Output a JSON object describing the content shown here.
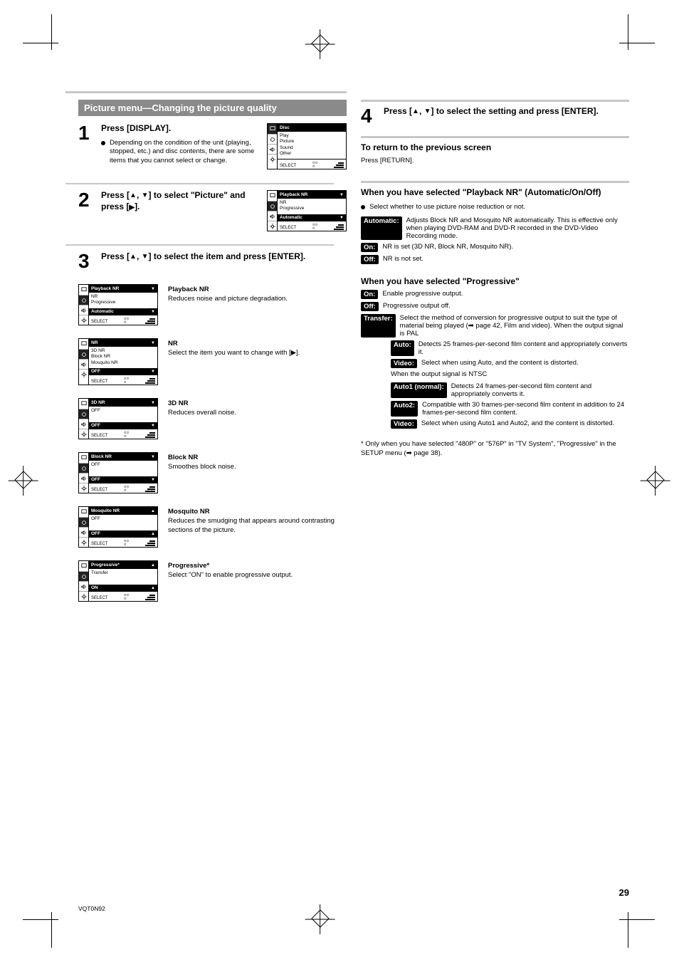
{
  "page_number": "29",
  "footer": "VQT0N92",
  "section": {
    "title": "Picture menu—Changing the picture quality"
  },
  "left": {
    "step1": {
      "no": "1",
      "title": "Press [DISPLAY].",
      "bullet": "Depending on the condition of the unit (playing, stopped, etc.) and disc contents, there are some items that you cannot select or change.",
      "panel": {
        "head": "Disc",
        "rows": [
          "Play",
          "Picture",
          "Sound",
          "Other"
        ],
        "footer_label": "SELECT"
      }
    },
    "step2": {
      "no": "2",
      "title_parts": [
        "Press [",
        "▲",
        ", ",
        "▼",
        "] to select \"Picture\" and press [",
        "▶",
        "]."
      ],
      "panel": {
        "head": "Playback NR",
        "rows": [
          "NR",
          "Progressive"
        ],
        "footer_label": "SELECT",
        "sub_value": "Automatic"
      }
    },
    "step3": {
      "no": "3",
      "title_parts": [
        "Press [",
        "▲",
        ", ",
        "▼",
        "] to select the item and press [ENTER]."
      ]
    }
  },
  "panels": [
    {
      "head": "Playback NR",
      "sub_value": "Automatic",
      "sub_label": "Automatic",
      "desc_head": "Playback NR",
      "desc": "Reduces noise and picture degradation.",
      "list_rows": [
        "NR",
        "Progressive"
      ]
    },
    {
      "head": "NR",
      "sub_value": "Block NR",
      "sub_label": "OFF",
      "desc_head": "NR",
      "desc": "Select the item you want to change with [▶].",
      "list_rows": [
        "3D NR",
        "Block NR",
        "Mosquito NR"
      ]
    },
    {
      "head": "3D NR",
      "sub_value": "OFF",
      "sub_label": "OFF",
      "desc_head": "3D NR",
      "desc": "Reduces overall noise.",
      "list_rows": [
        "OFF"
      ]
    },
    {
      "head": "Block NR",
      "sub_value": "OFF",
      "sub_label": "OFF",
      "desc_head": "Block NR",
      "desc": "Smoothes block noise.",
      "list_rows": [
        "OFF"
      ]
    },
    {
      "head": "Mosquito NR",
      "sub_value": "OFF",
      "sub_label": "OFF",
      "desc_head": "Mosquito NR",
      "desc": "Reduces the smudging that appears around contrasting sections of the picture.",
      "list_rows": [
        "OFF"
      ]
    },
    {
      "head": "Progressive*",
      "sub_value": "ON",
      "sub_label": "ON",
      "desc_head": "Progressive*",
      "desc": "Select \"ON\" to enable progressive output.",
      "list_rows": [
        "Transfer"
      ]
    }
  ],
  "right": {
    "step4": {
      "no": "4",
      "title_parts": [
        "Press [",
        "▲",
        ", ",
        "▼",
        "] to select the setting and press [ENTER]."
      ]
    },
    "return_title": "To return to the previous screen",
    "return_text": "Press [RETURN].",
    "playbackNR": {
      "title_lead": "When you have selected \"Playback NR\" (Automatic/On/Off)",
      "bullet": "Select whether to use picture noise reduction or not.",
      "auto": {
        "label": "Automatic:",
        "text": "Adjusts Block NR and Mosquito NR automatically. This is effective only when playing DVD-RAM and DVD-R recorded in the DVD-Video Recording mode."
      },
      "on": {
        "label": "On:",
        "text": "NR is set (3D NR, Block NR, Mosquito NR)."
      },
      "off": {
        "label": "Off:",
        "text": "NR is not set."
      }
    },
    "prog": {
      "title_lead": "When you have selected \"Progressive\"",
      "on": {
        "label": "On:",
        "text": "Enable progressive output."
      },
      "off": {
        "label": "Off:",
        "text": "Progressive output off."
      },
      "transfer": {
        "label": "Transfer:",
        "text": "Select the method of conversion for progressive output to suit the type of material being played (➡ page 42, Film and video). When the output signal is PAL"
      },
      "auto": {
        "label": "Auto:",
        "text": "Detects 25 frames-per-second film content and appropriately converts it."
      },
      "video": {
        "label": "Video:",
        "text": "Select when using Auto, and the content is distorted."
      },
      "ntsc": "When the output signal is NTSC",
      "auto1": {
        "label": "Auto1 (normal):",
        "text": "Detects 24 frames-per-second film content and appropriately converts it."
      },
      "auto2": {
        "label": "Auto2:",
        "text": "Compatible with 30 frames-per-second film content in addition to 24 frames-per-second film content."
      },
      "video2": {
        "label": "Video:",
        "text": "Select when using Auto1 and Auto2, and the content is distorted."
      }
    },
    "footnote": "* Only when you have selected \"480P\" or \"576P\" in \"TV System\", \"Progressive\" in the SETUP menu (➡ page 38)."
  }
}
